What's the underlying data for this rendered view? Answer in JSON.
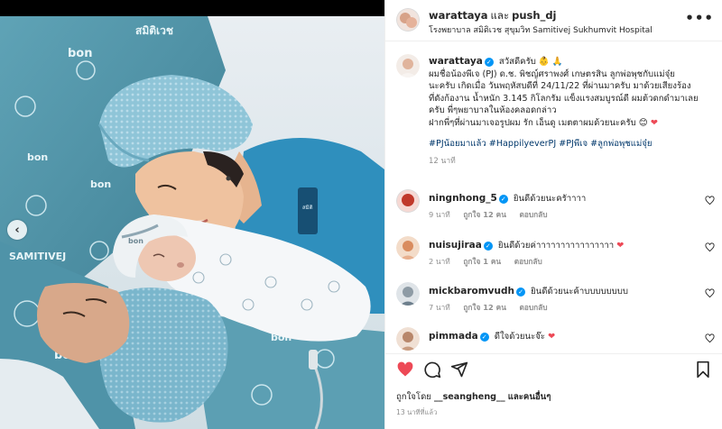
{
  "header": {
    "user1": "warattaya",
    "and": "และ",
    "user2": "push_dj",
    "location": "โรงพยาบาล สมิติเวช สุขุมวิท Samitivej Sukhumvit Hospital",
    "more_icon": "more-horizontal-icon"
  },
  "caption": {
    "username": "warattaya",
    "verified": "✓",
    "greeting": "สวัสดีครับ 👶 🙏",
    "lines": [
      "ผมชื่อน้องพีเจ (PJ) ด.ช. พิชญ์ศราพงศ์ เกษตรสิน ลูกพ่อพุชกับแม่จุ๋ย",
      "นะครับ เกิดเมื่อ วันพฤหัสบดีที่ 24/11/22 ที่ผ่านมาครับ มาด้วยเสียงร้อง",
      "ที่ดังก้องาน น้ำหนัก 3.145 กิโลกรัม แข็งแรงสมบูรณ์ดี ผมต้วดกดำมาเลย",
      "ครับ พี่ๆพยาบาลในห้องคลอดกล่าว",
      "ฝากพี่ๆที่ผ่านมาเจอรูปผม รัก เอ็นดู เมตตาผมด้วยนะครับ 😊"
    ],
    "heart": "❤",
    "tags": "#PJน้อยมาแล้ว #HappilyeverPJ #PJพีเจ #ลูกพ่อพุชแม่จุ๋ย",
    "time": "12 นาที"
  },
  "comments": [
    {
      "username": "ningnhong_5",
      "verified": true,
      "text": "ยินดีด้วยนะครัาาาา",
      "time": "9 นาที",
      "likes": "ถูกใจ 12 คน",
      "reply": "ตอบกลับ",
      "avatar_color": "#c0392b",
      "heart": ""
    },
    {
      "username": "nuisujiraa",
      "verified": true,
      "text": "ยินดีด้วยค่าาาาาาาาาาาาาาาา",
      "time": "2 นาที",
      "likes": "ถูกใจ 1 คน",
      "reply": "ตอบกลับ",
      "avatar_color": "#d98c5f",
      "heart": "❤"
    },
    {
      "username": "mickbaromvudh",
      "verified": true,
      "text": "ยินดีด้วยนะค้าบบบบบบบบ",
      "time": "7 นาที",
      "likes": "ถูกใจ 12 คน",
      "reply": "ตอบกลับ",
      "avatar_color": "#6d7f8c",
      "heart": ""
    },
    {
      "username": "pimmada",
      "verified": true,
      "text": "ดีใจด้วยนะจ๊ะ",
      "time": "",
      "likes": "",
      "reply": "",
      "avatar_color": "#b8876b",
      "heart": "❤"
    }
  ],
  "actions": {
    "like_icon": "heart-filled-icon",
    "comment_icon": "comment-icon",
    "share_icon": "share-icon",
    "save_icon": "bookmark-icon",
    "like_color": "#ed4956"
  },
  "likes": {
    "prefix": "ถูกใจโดย",
    "user": "__seangheng__",
    "suffix": "และคนอื่นๆ"
  },
  "posted": "13 นาทีที่แล้ว",
  "photo": {
    "brand_text": "สมิติเวช",
    "brand_latin": "SAMITIVEJ",
    "bon": "bon",
    "prev_icon": "chevron-left-icon"
  }
}
